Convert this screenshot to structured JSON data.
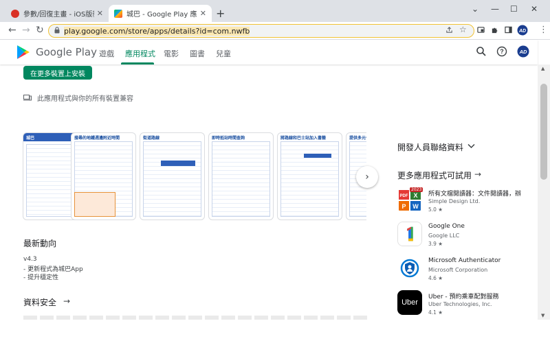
{
  "browser": {
    "tabs": [
      {
        "label": "參數/回復主畫 - iOS版新巴城巴App",
        "active": false
      },
      {
        "label": "城巴 - Google Play 應用程式",
        "active": true
      }
    ],
    "new_tab_symbol": "+",
    "url": "play.google.com/store/apps/details?id=com.nwfb",
    "window_controls": {
      "dropdown": "⌄",
      "minimize": "—",
      "maximize": "☐",
      "close": "✕"
    },
    "nav": {
      "back": "←",
      "forward": "→",
      "reload": "↻"
    },
    "toolbar_icons": [
      "share-icon",
      "bookmark-star-icon",
      "extension-icon",
      "puzzle-icon",
      "sidepanel-icon",
      "profile-icon",
      "menu-icon"
    ],
    "menu_symbol": "⋮",
    "star_symbol": "☆"
  },
  "header": {
    "brand": "Google Play",
    "nav": [
      {
        "label": "遊戲",
        "active": false
      },
      {
        "label": "應用程式",
        "active": true
      },
      {
        "label": "電影",
        "active": false
      },
      {
        "label": "圖書",
        "active": false
      },
      {
        "label": "兒童",
        "active": false
      }
    ]
  },
  "main": {
    "install_button": "在更多裝置上安裝",
    "compat_text": "此應用程式與你的所有裝置兼容",
    "screenshots": [
      {
        "title": "城巴"
      },
      {
        "title": "搜尋的地鐵週邊附近時間"
      },
      {
        "title": "街道路線"
      },
      {
        "title": "即時抵站時間查詢"
      },
      {
        "title": "將路線和巴士站加入書籤"
      },
      {
        "title": "提供多元化"
      }
    ],
    "whats_new": {
      "heading": "最新動向",
      "version": "v4.3",
      "lines": [
        "- 更新程式為城巴App",
        "- 提升穩定性"
      ]
    },
    "data_safety": {
      "heading": "資料安全"
    }
  },
  "sidebar": {
    "developer_contact": "開發人員聯絡資料",
    "more_apps_heading": "更多應用程式可試用",
    "apps": [
      {
        "name": "所有文檔閱讀器：文件閱讀器，辦",
        "developer": "Simple Design Ltd.",
        "rating": "5.0 ★"
      },
      {
        "name": "Google One",
        "developer": "Google LLC",
        "rating": "3.9 ★"
      },
      {
        "name": "Microsoft Authenticator",
        "developer": "Microsoft Corporation",
        "rating": "4.6 ★"
      },
      {
        "name": "Uber - 預約乘車配對服務",
        "developer": "Uber Technologies, Inc.",
        "rating": "4.1 ★"
      }
    ],
    "uber_icon_text": "Uber",
    "doc_badge": "2023"
  },
  "colors": {
    "play_green": "#01875f",
    "tab_bar": "#dee1e6",
    "omnibox_highlight": "#fce8b2"
  }
}
